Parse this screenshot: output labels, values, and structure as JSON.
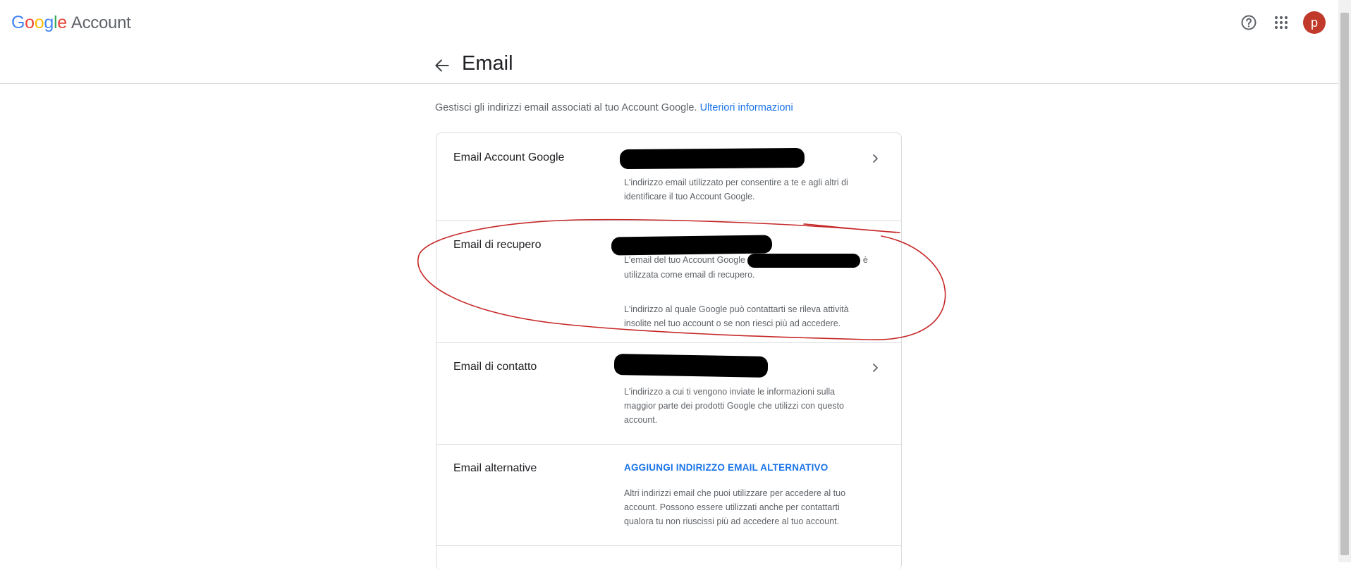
{
  "header": {
    "logo_letters": [
      "G",
      "o",
      "o",
      "g",
      "l",
      "e"
    ],
    "logo_suffix": "Account",
    "help_icon": "help-circle-icon",
    "apps_icon": "apps-grid-icon",
    "avatar_initial": "p"
  },
  "page": {
    "back_icon": "arrow-back-icon",
    "title": "Email",
    "intro": "Gestisci gli indirizzi email associati al tuo Account Google.",
    "intro_link": "Ulteriori informazioni"
  },
  "rows": [
    {
      "label": "Email Account Google",
      "desc": "L'indirizzo email utilizzato per consentire a te e agli altri di identificare il tuo Account Google."
    },
    {
      "label": "Email di recupero",
      "desc1_a": "L'email del tuo Account Google",
      "desc1_b": "è utilizzata come email di recupero.",
      "desc2": "L'indirizzo al quale Google può contattarti se rileva attività insolite nel tuo account o se non riesci più ad accedere."
    },
    {
      "label": "Email di contatto",
      "desc": "L'indirizzo a cui ti vengono inviate le informazioni sulla maggior parte dei prodotti Google che utilizzi con questo account."
    },
    {
      "label": "Email alternative",
      "action": "AGGIUNGI INDIRIZZO EMAIL ALTERNATIVO",
      "desc": "Altri indirizzi email che puoi utilizzare per accedere al tuo account. Possono essere utilizzati anche per contattarti qualora tu non riuscissi più ad accedere al tuo account."
    }
  ],
  "colors": {
    "accent": "#1a73e8",
    "annotation": "#c62828",
    "avatar": "#c0392b"
  }
}
